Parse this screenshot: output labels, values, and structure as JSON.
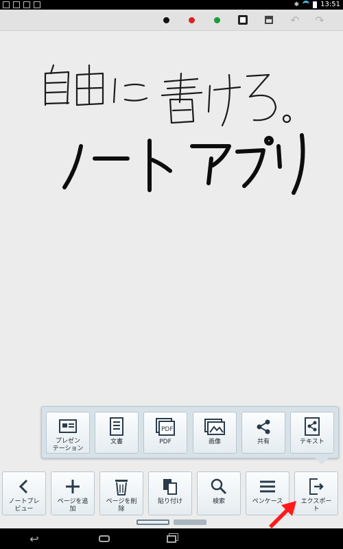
{
  "status_bar": {
    "time": "13:51"
  },
  "toolbar": {
    "colors": {
      "black": "#111111",
      "red": "#e02020",
      "green": "#1a9a3a"
    },
    "icons": [
      "black-pen-dot",
      "red-pen-dot",
      "green-pen-dot",
      "film-icon",
      "eraser-icon",
      "undo-icon",
      "redo-icon"
    ]
  },
  "canvas": {
    "line1": "自由に書ける。",
    "line2": "ノートアプリ"
  },
  "export_menu": {
    "items": [
      {
        "label": "プレゼン\nテーション",
        "icon": "presentation-icon"
      },
      {
        "label": "文書",
        "icon": "document-icon"
      },
      {
        "label": "PDF",
        "icon": "pdf-icon"
      },
      {
        "label": "画像",
        "icon": "image-icon"
      },
      {
        "label": "共有",
        "icon": "share-icon"
      },
      {
        "label": "テキスト",
        "icon": "text-export-icon"
      }
    ]
  },
  "main_menu": {
    "items": [
      {
        "label": "ノートプレ\nビュー",
        "icon": "chevron-left-icon"
      },
      {
        "label": "ページを追\n加",
        "icon": "plus-icon"
      },
      {
        "label": "ページを削\n除",
        "icon": "trash-icon"
      },
      {
        "label": "貼り付け",
        "icon": "paste-icon"
      },
      {
        "label": "検索",
        "icon": "search-icon"
      },
      {
        "label": "ペンケース",
        "icon": "pen-case-icon"
      },
      {
        "label": "エクスポー\nト",
        "icon": "export-icon"
      }
    ]
  },
  "accent": {
    "annotation_arrow": "#ff1a1a",
    "menu_bg": "#d7e2e8"
  }
}
